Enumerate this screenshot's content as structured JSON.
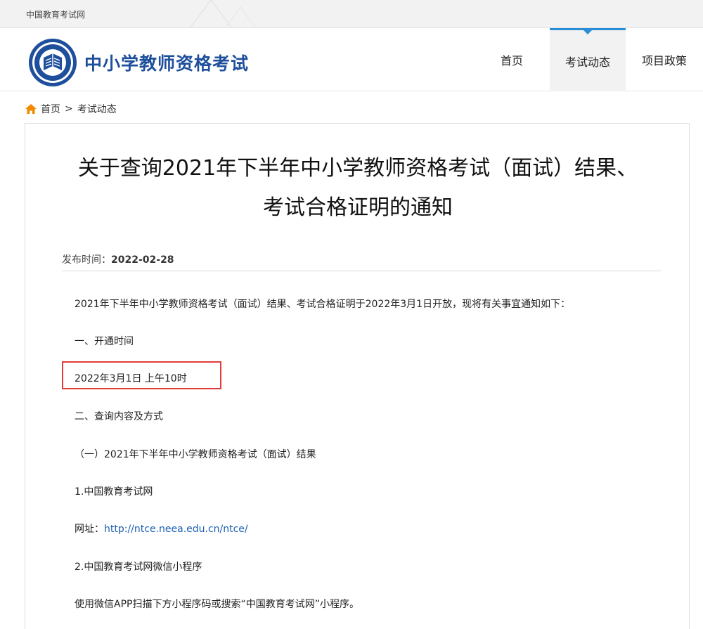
{
  "topbar": {
    "site_name": "中国教育考试网"
  },
  "header": {
    "brand": "中小学教师资格考试",
    "nav": {
      "home": "首页",
      "news": "考试动态",
      "policy": "项目政策"
    }
  },
  "breadcrumb": {
    "home": "首页",
    "separator": ">",
    "current": "考试动态"
  },
  "article": {
    "title_line1": "关于查询2021年下半年中小学教师资格考试（面试）结果、",
    "title_line2": "考试合格证明的通知",
    "publish_label": "发布时间：",
    "publish_date": "2022-02-28",
    "intro": "2021年下半年中小学教师资格考试（面试）结果、考试合格证明于2022年3月1日开放，现将有关事宜通知如下：",
    "sec1_heading": "一、开通时间",
    "open_time": "2022年3月1日 上午10时",
    "sec2_heading": "二、查询内容及方式",
    "sub1_heading": "（一）2021年下半年中小学教师资格考试（面试）结果",
    "item1": "1.中国教育考试网",
    "url_label": "网址：",
    "url": "http://ntce.neea.edu.cn/ntce/",
    "item2": "2.中国教育考试网微信小程序",
    "wechat_text": "使用微信APP扫描下方小程序码或搜索“中国教育考试网”小程序。"
  },
  "colors": {
    "brand_blue": "#1e4f9c",
    "nav_accent": "#2a8ed6",
    "highlight_red": "#e23c3c",
    "link_blue": "#1a5fb4",
    "home_icon": "#f08a00"
  },
  "icons": {
    "home": "home-icon",
    "logo": "ntce-logo-emblem"
  }
}
